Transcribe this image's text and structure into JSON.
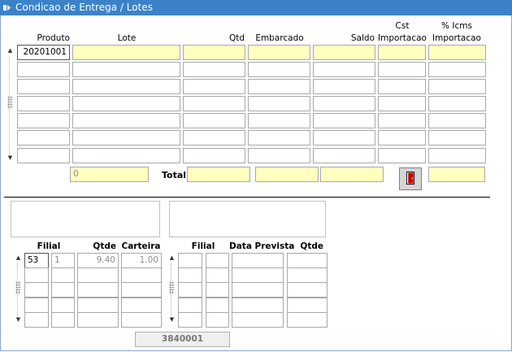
{
  "window": {
    "title": "Condicao de Entrega / Lotes",
    "title_icon": "form-icon"
  },
  "lotes": {
    "headers": {
      "produto": "Produto",
      "lote": "Lote",
      "qtd": "Qtd",
      "embarcado": "Embarcado",
      "saldo": "Saldo",
      "cst_line1": "Cst",
      "cst_line2": "Importacao",
      "icms_line1": "% Icms",
      "icms_line2": "Importacao"
    },
    "rows": [
      {
        "produto": "20201001",
        "lote": "",
        "qtd": "",
        "embarcado": "",
        "saldo": "",
        "cst": "",
        "icms": ""
      },
      {
        "produto": "",
        "lote": "",
        "qtd": "",
        "embarcado": "",
        "saldo": "",
        "cst": "",
        "icms": ""
      },
      {
        "produto": "",
        "lote": "",
        "qtd": "",
        "embarcado": "",
        "saldo": "",
        "cst": "",
        "icms": ""
      },
      {
        "produto": "",
        "lote": "",
        "qtd": "",
        "embarcado": "",
        "saldo": "",
        "cst": "",
        "icms": ""
      },
      {
        "produto": "",
        "lote": "",
        "qtd": "",
        "embarcado": "",
        "saldo": "",
        "cst": "",
        "icms": ""
      },
      {
        "produto": "",
        "lote": "",
        "qtd": "",
        "embarcado": "",
        "saldo": "",
        "cst": "",
        "icms": ""
      },
      {
        "produto": "",
        "lote": "",
        "qtd": "",
        "embarcado": "",
        "saldo": "",
        "cst": "",
        "icms": ""
      }
    ],
    "count_value": "0",
    "total_label": "Total",
    "total_qtd": "",
    "total_embarcado": "",
    "total_saldo": "",
    "total_icms": "",
    "exit_icon": "exit-door-icon"
  },
  "filial_estoque": {
    "headers": {
      "filial": "Filial",
      "qtde": "Qtde",
      "carteira": "Carteira"
    },
    "rows": [
      {
        "filial": "53",
        "sub": "1",
        "qtde": "9.40",
        "carteira": "1.00"
      },
      {
        "filial": "",
        "sub": "",
        "qtde": "",
        "carteira": ""
      },
      {
        "filial": "",
        "sub": "",
        "qtde": "",
        "carteira": ""
      },
      {
        "filial": "",
        "sub": "",
        "qtde": "",
        "carteira": ""
      },
      {
        "filial": "",
        "sub": "",
        "qtde": "",
        "carteira": ""
      }
    ]
  },
  "previsao": {
    "headers": {
      "filial": "Filial",
      "data_prevista": "Data Prevista",
      "qtde": "Qtde"
    },
    "rows": [
      {
        "filial": "",
        "sub": "",
        "data": "",
        "qtde": ""
      },
      {
        "filial": "",
        "sub": "",
        "data": "",
        "qtde": ""
      },
      {
        "filial": "",
        "sub": "",
        "data": "",
        "qtde": ""
      },
      {
        "filial": "",
        "sub": "",
        "data": "",
        "qtde": ""
      },
      {
        "filial": "",
        "sub": "",
        "data": "",
        "qtde": ""
      }
    ]
  },
  "footer": {
    "code": "3840001"
  },
  "colors": {
    "titlebar": "#3c82c8",
    "field_yellow": "#ffffc0",
    "field_border": "#a8a8a8"
  }
}
